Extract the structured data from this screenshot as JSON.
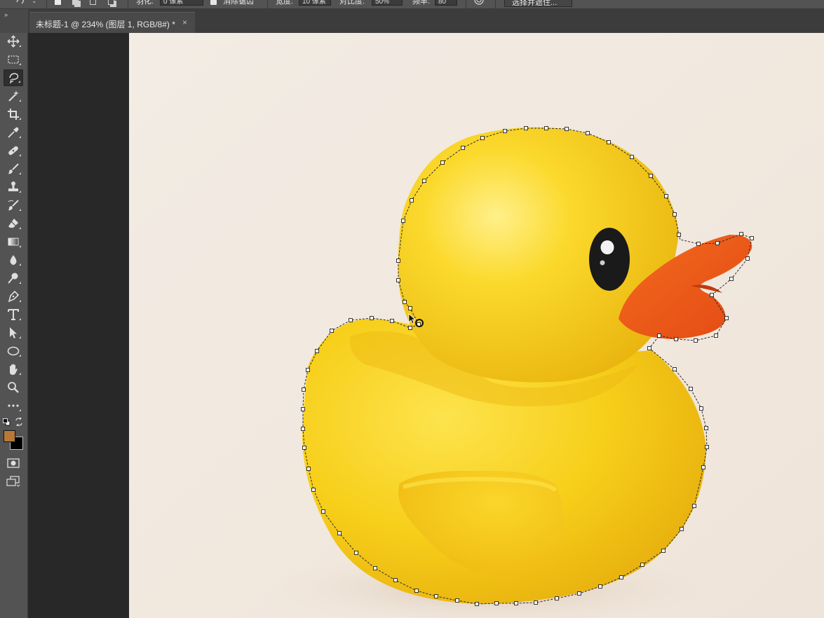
{
  "options_bar": {
    "feather_label": "羽化:",
    "feather_value": "0 像素",
    "antialias_label": "消除锯齿",
    "width_label": "宽度:",
    "width_value": "10 像素",
    "contrast_label": "对比度:",
    "contrast_value": "50%",
    "frequency_label": "频率:",
    "frequency_value": "80",
    "select_mask_button": "选择并遮住..."
  },
  "document_tab": {
    "title": "未标题-1 @ 234% (图层 1, RGB/8#) *",
    "close": "×"
  },
  "toolbar": {
    "tools": [
      "move-tool",
      "marquee-tool",
      "magnetic-lasso-tool",
      "magic-wand-tool",
      "crop-tool",
      "eyedropper-tool",
      "healing-brush-tool",
      "brush-tool",
      "clone-stamp-tool",
      "history-brush-tool",
      "eraser-tool",
      "gradient-tool",
      "blur-tool",
      "dodge-tool",
      "pen-tool",
      "type-tool",
      "path-selection-tool",
      "ellipse-tool",
      "hand-tool",
      "zoom-tool",
      "edit-toolbar"
    ],
    "selected_tool": "magnetic-lasso-tool",
    "foreground_color": "#b8783a",
    "background_color": "#000000"
  },
  "canvas": {
    "background_color": "#f2ebe3",
    "subject": "rubber-duck",
    "duck_body_color": "#f7cf1a",
    "beak_color": "#f05a18",
    "eye_color": "#1a1a1a"
  }
}
